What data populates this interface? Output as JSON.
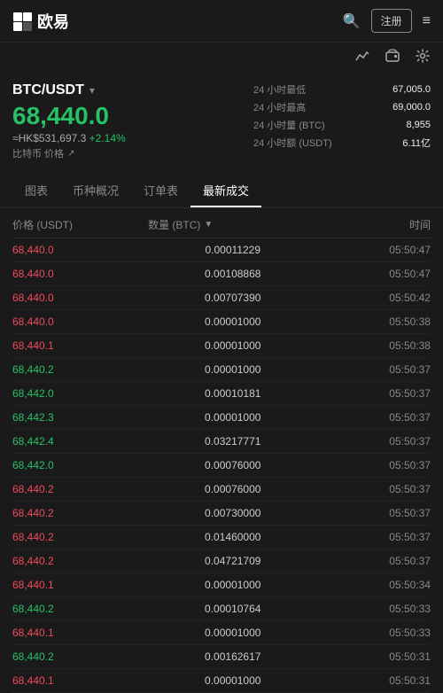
{
  "header": {
    "logo_text": "欧易",
    "register_label": "注册",
    "menu_icon": "≡"
  },
  "sub_header": {
    "chart_icon": "chart",
    "wallet_icon": "wallet",
    "settings_icon": "settings"
  },
  "trading": {
    "pair": "BTC/USDT",
    "price": "68,440.0",
    "price_hk": "≈HK$531,697.3",
    "change": "+2.14%",
    "subtitle": "比特币 价格",
    "stats": [
      {
        "label": "24 小时最低",
        "value": "67,005.0"
      },
      {
        "label": "24 小时最高",
        "value": "69,000.0"
      },
      {
        "label": "24 小时量 (BTC)",
        "value": "8,955"
      },
      {
        "label": "24 小时额 (USDT)",
        "value": "6.11亿"
      }
    ]
  },
  "tabs": [
    {
      "label": "图表",
      "active": false
    },
    {
      "label": "币种概况",
      "active": false
    },
    {
      "label": "订单表",
      "active": false
    },
    {
      "label": "最新成交",
      "active": true
    }
  ],
  "trade_table": {
    "columns": {
      "price": "价格 (USDT)",
      "amount": "数量 (BTC)",
      "time": "时间"
    },
    "rows": [
      {
        "price": "68,440.0",
        "color": "red",
        "amount": "0.00011229",
        "time": "05:50:47"
      },
      {
        "price": "68,440.0",
        "color": "red",
        "amount": "0.00108868",
        "time": "05:50:47"
      },
      {
        "price": "68,440.0",
        "color": "red",
        "amount": "0.00707390",
        "time": "05:50:42"
      },
      {
        "price": "68,440.0",
        "color": "red",
        "amount": "0.00001000",
        "time": "05:50:38"
      },
      {
        "price": "68,440.1",
        "color": "red",
        "amount": "0.00001000",
        "time": "05:50:38"
      },
      {
        "price": "68,440.2",
        "color": "green",
        "amount": "0.00001000",
        "time": "05:50:37"
      },
      {
        "price": "68,442.0",
        "color": "green",
        "amount": "0.00010181",
        "time": "05:50:37"
      },
      {
        "price": "68,442.3",
        "color": "green",
        "amount": "0.00001000",
        "time": "05:50:37"
      },
      {
        "price": "68,442.4",
        "color": "green",
        "amount": "0.03217771",
        "time": "05:50:37"
      },
      {
        "price": "68,442.0",
        "color": "green",
        "amount": "0.00076000",
        "time": "05:50:37"
      },
      {
        "price": "68,440.2",
        "color": "red",
        "amount": "0.00076000",
        "time": "05:50:37"
      },
      {
        "price": "68,440.2",
        "color": "red",
        "amount": "0.00730000",
        "time": "05:50:37"
      },
      {
        "price": "68,440.2",
        "color": "red",
        "amount": "0.01460000",
        "time": "05:50:37"
      },
      {
        "price": "68,440.2",
        "color": "red",
        "amount": "0.04721709",
        "time": "05:50:37"
      },
      {
        "price": "68,440.1",
        "color": "red",
        "amount": "0.00001000",
        "time": "05:50:34"
      },
      {
        "price": "68,440.2",
        "color": "green",
        "amount": "0.00010764",
        "time": "05:50:33"
      },
      {
        "price": "68,440.1",
        "color": "red",
        "amount": "0.00001000",
        "time": "05:50:33"
      },
      {
        "price": "68,440.2",
        "color": "green",
        "amount": "0.00162617",
        "time": "05:50:31"
      },
      {
        "price": "68,440.1",
        "color": "red",
        "amount": "0.00001000",
        "time": "05:50:31"
      }
    ]
  }
}
